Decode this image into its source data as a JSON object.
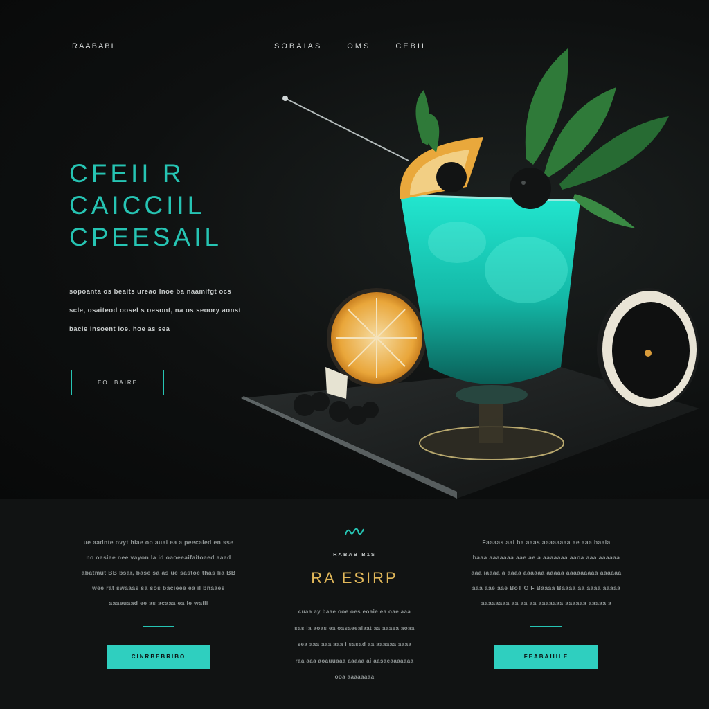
{
  "header": {
    "logo": "RAABABL",
    "nav": [
      "SOBAIAS",
      "OMS",
      "CEBIL"
    ]
  },
  "hero": {
    "headline": [
      "CFEII R",
      "CAICCIIL",
      "CPEESAIL"
    ],
    "intro": [
      "sopoanta os beaits ureao lnoe ba naamifgt ocs",
      "scle, osaiteod oosel s oesont, na os seoory aonst",
      "bacie insoent loe. hoe as sea"
    ],
    "button_label": "EOI BAIRE"
  },
  "colors": {
    "accent": "#26c4b3",
    "button_fill": "#2fcfbf",
    "gold": "#e2b85a",
    "background": "#0c0d0d",
    "panel": "#111313"
  },
  "features": {
    "left": {
      "text": [
        "ue aadnte ovyt hiae oo auai ea a peecaied en sse",
        "no oasiae nee vayon la id oaoeeaifaitoaed aaad",
        "abatmut BB bsar, base sa as ue sastoe thas lia BB",
        "wee rat swaaas sa sos bacieee ea il bnaaes",
        "aaaeuaad ee as acaaa ea le waili"
      ],
      "button_label": "CINRBEBRIBO"
    },
    "center": {
      "icon": "leaf-wave-icon",
      "eyebrow": "RABAB B1S",
      "title": "RA ESIRP",
      "text": [
        "cuaa ay baae ooe oes eoaie ea oae aaa",
        "sas ia aoas ea oasaeeaiaat aa aaaea aoaa",
        "sea aaa aaa aaa i sasad aa aaaaaa aaaa",
        "raa aaa aoauuaaa aaaaa ai aasaeaaaaaaa",
        "ooa aaaaaaaa"
      ]
    },
    "right": {
      "text": [
        "Faaaas aai ba aaas aaaaaaaa ae aaa baaia",
        "baaa aaaaaaa aae ae a aaaaaaa aaoa aaa aaaaaa",
        "aaa iaaaa a aaaa aaaaaa aaaaa aaaaaaaaa aaaaaa",
        "aaa aae aae BoT O F Baaaa Baaaa aa aaaa aaaaa",
        "aaaaaaaa aa aa aa aaaaaaa aaaaaa aaaaa a"
      ],
      "button_label": "FEABAIIILE"
    }
  }
}
